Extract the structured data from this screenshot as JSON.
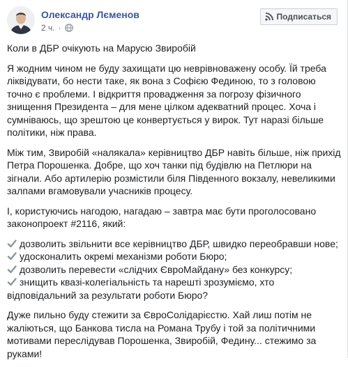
{
  "post": {
    "author": "Олександр Лєменов",
    "time": "2 ч.",
    "separator": "·",
    "subscribe_label": "Подписаться",
    "title": "Коли в ДБР очікують на Марусю Звиробій",
    "paragraphs": [
      "Я жодним чином не буду захищати цю неврівноважену особу. Їй треба ліквідувати, бо нести таке, як вона з Софією Фединою, то з головою точно є проблеми. І відкриття провадження за погрозу фізичного знищення Президента – для мене цілком адекватний процес. Хоча і сумніваюсь, що зрештою це конвертується у вирок. Тут наразі більше політики, ніж права.",
      "Між тим, Звиробій «налякала» керівництво ДБР навіть більше, ніж прихід Петра Порошенка. Добре, що хоч танки під будівлю на Петлюри на зігнали. Або артилерію розмістили біля Південного вокзалу, невеликими залпами вгамовували учасників процесу.",
      "І, користуючись нагодою, нагадаю – завтра має бути проголосовано законопроект #2116, який:"
    ],
    "list_items": [
      "дозволить звільнити все керівництво ДБР, швидко переобравши нове;",
      "удосконалить окремі механізми роботи Бюро;",
      "дозволить перевести «слідчих ЄвроМайдану» без конкурсу;",
      "знищить квазі-колегіальність та нарешті зрозуміємо, хто відповідальний за результати роботи Бюро?"
    ],
    "closing": "Дуже пильно буду стежити за ЄвроСолідарієстю. Хай лиш потім не жаліються, що Банкова тисла на Романа Трубу і той за політичними мотивами переслідував Порошенка, Звиробій, Федину... стежимо за руками!"
  },
  "icons": {
    "avatar": "avatar-photo",
    "globe": "globe-icon",
    "subscribe": "rss-icon",
    "check": "check-mark-icon"
  },
  "colors": {
    "author_link": "#385898",
    "meta_text": "#616770",
    "check_mark": "#8d949e"
  }
}
